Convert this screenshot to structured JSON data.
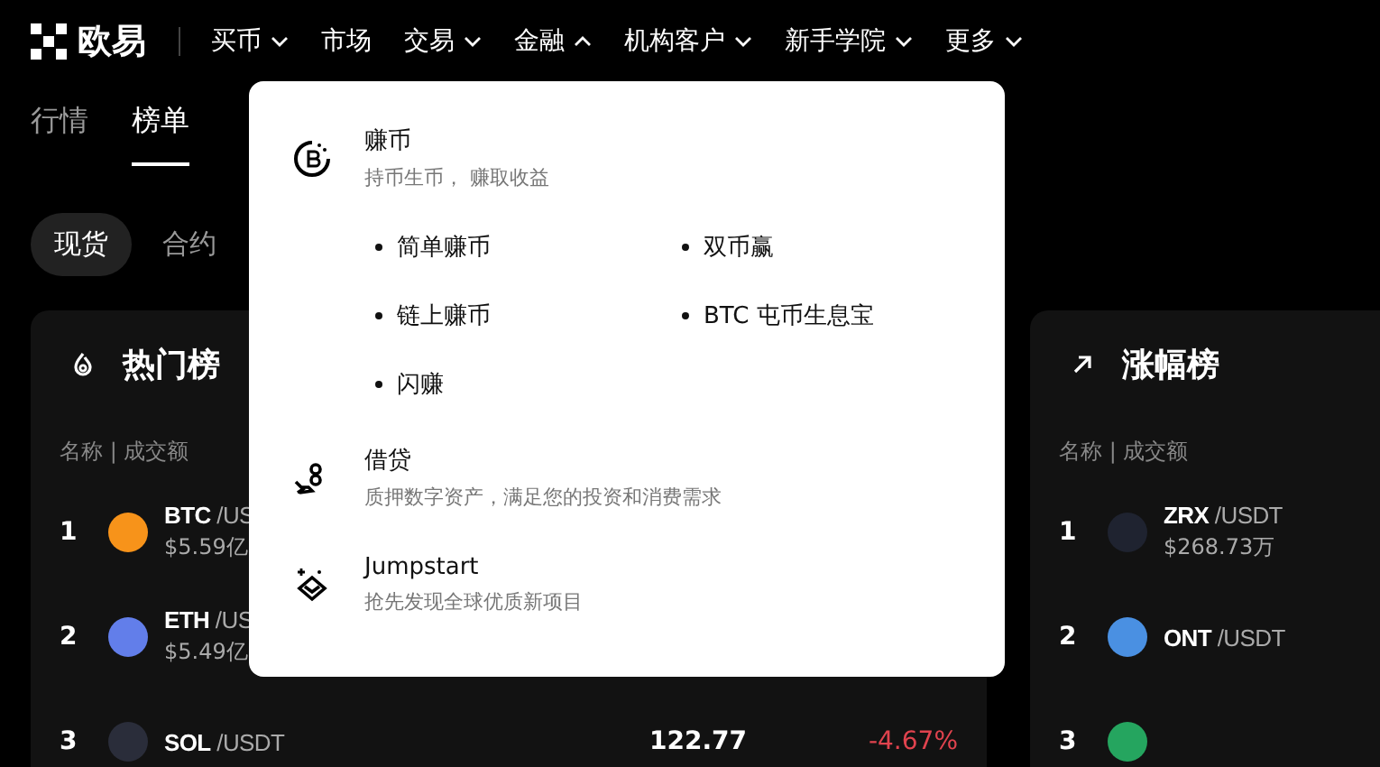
{
  "logo": {
    "text": "欧易"
  },
  "nav": [
    {
      "label": "买币",
      "kind": "menu",
      "expanded": false
    },
    {
      "label": "市场",
      "kind": "link"
    },
    {
      "label": "交易",
      "kind": "menu",
      "expanded": false
    },
    {
      "label": "金融",
      "kind": "menu",
      "expanded": true
    },
    {
      "label": "机构客户",
      "kind": "menu",
      "expanded": false
    },
    {
      "label": "新手学院",
      "kind": "menu",
      "expanded": false
    },
    {
      "label": "更多",
      "kind": "menu",
      "expanded": false
    }
  ],
  "subtabs": [
    {
      "label": "行情",
      "selected": false
    },
    {
      "label": "榜单",
      "selected": true
    }
  ],
  "market_types": [
    {
      "label": "现货",
      "selected": true
    },
    {
      "label": "合约",
      "selected": false
    }
  ],
  "cards": [
    {
      "kind": "hot",
      "title": "热门榜",
      "header": "名称 | 成交额",
      "rows": [
        {
          "rank": "1",
          "base": "BTC",
          "quote": "/US",
          "volume": "$5.59亿",
          "color": "#f7931a"
        },
        {
          "rank": "2",
          "base": "ETH",
          "quote": "/US",
          "volume": "$5.49亿",
          "color": "#627eea"
        },
        {
          "rank": "3",
          "base": "SOL",
          "quote": "/USDT",
          "price": "122.77",
          "change": "-4.67%",
          "color": "#2a2d3a"
        }
      ]
    },
    {
      "kind": "gainers",
      "title": "涨幅榜",
      "header": "名称 | 成交额",
      "rows": [
        {
          "rank": "1",
          "base": "ZRX",
          "quote": "/USDT",
          "volume": "$268.73万",
          "color": "#1f2330"
        },
        {
          "rank": "2",
          "base": "ONT",
          "quote": "/USDT",
          "color": "#4a90e2"
        },
        {
          "rank": "3",
          "color": "#25a55f"
        }
      ]
    }
  ],
  "finance_menu": [
    {
      "kind": "earn",
      "title": "赚币",
      "desc": "持币生币， 赚取收益",
      "links": [
        "简单赚币",
        "双币赢",
        "链上赚币",
        "BTC 屯币生息宝",
        "闪赚"
      ]
    },
    {
      "kind": "loan",
      "title": "借贷",
      "desc": "质押数字资产，满足您的投资和消费需求"
    },
    {
      "kind": "jumpstart",
      "title": "Jumpstart",
      "desc": "抢先发现全球优质新项目"
    }
  ]
}
